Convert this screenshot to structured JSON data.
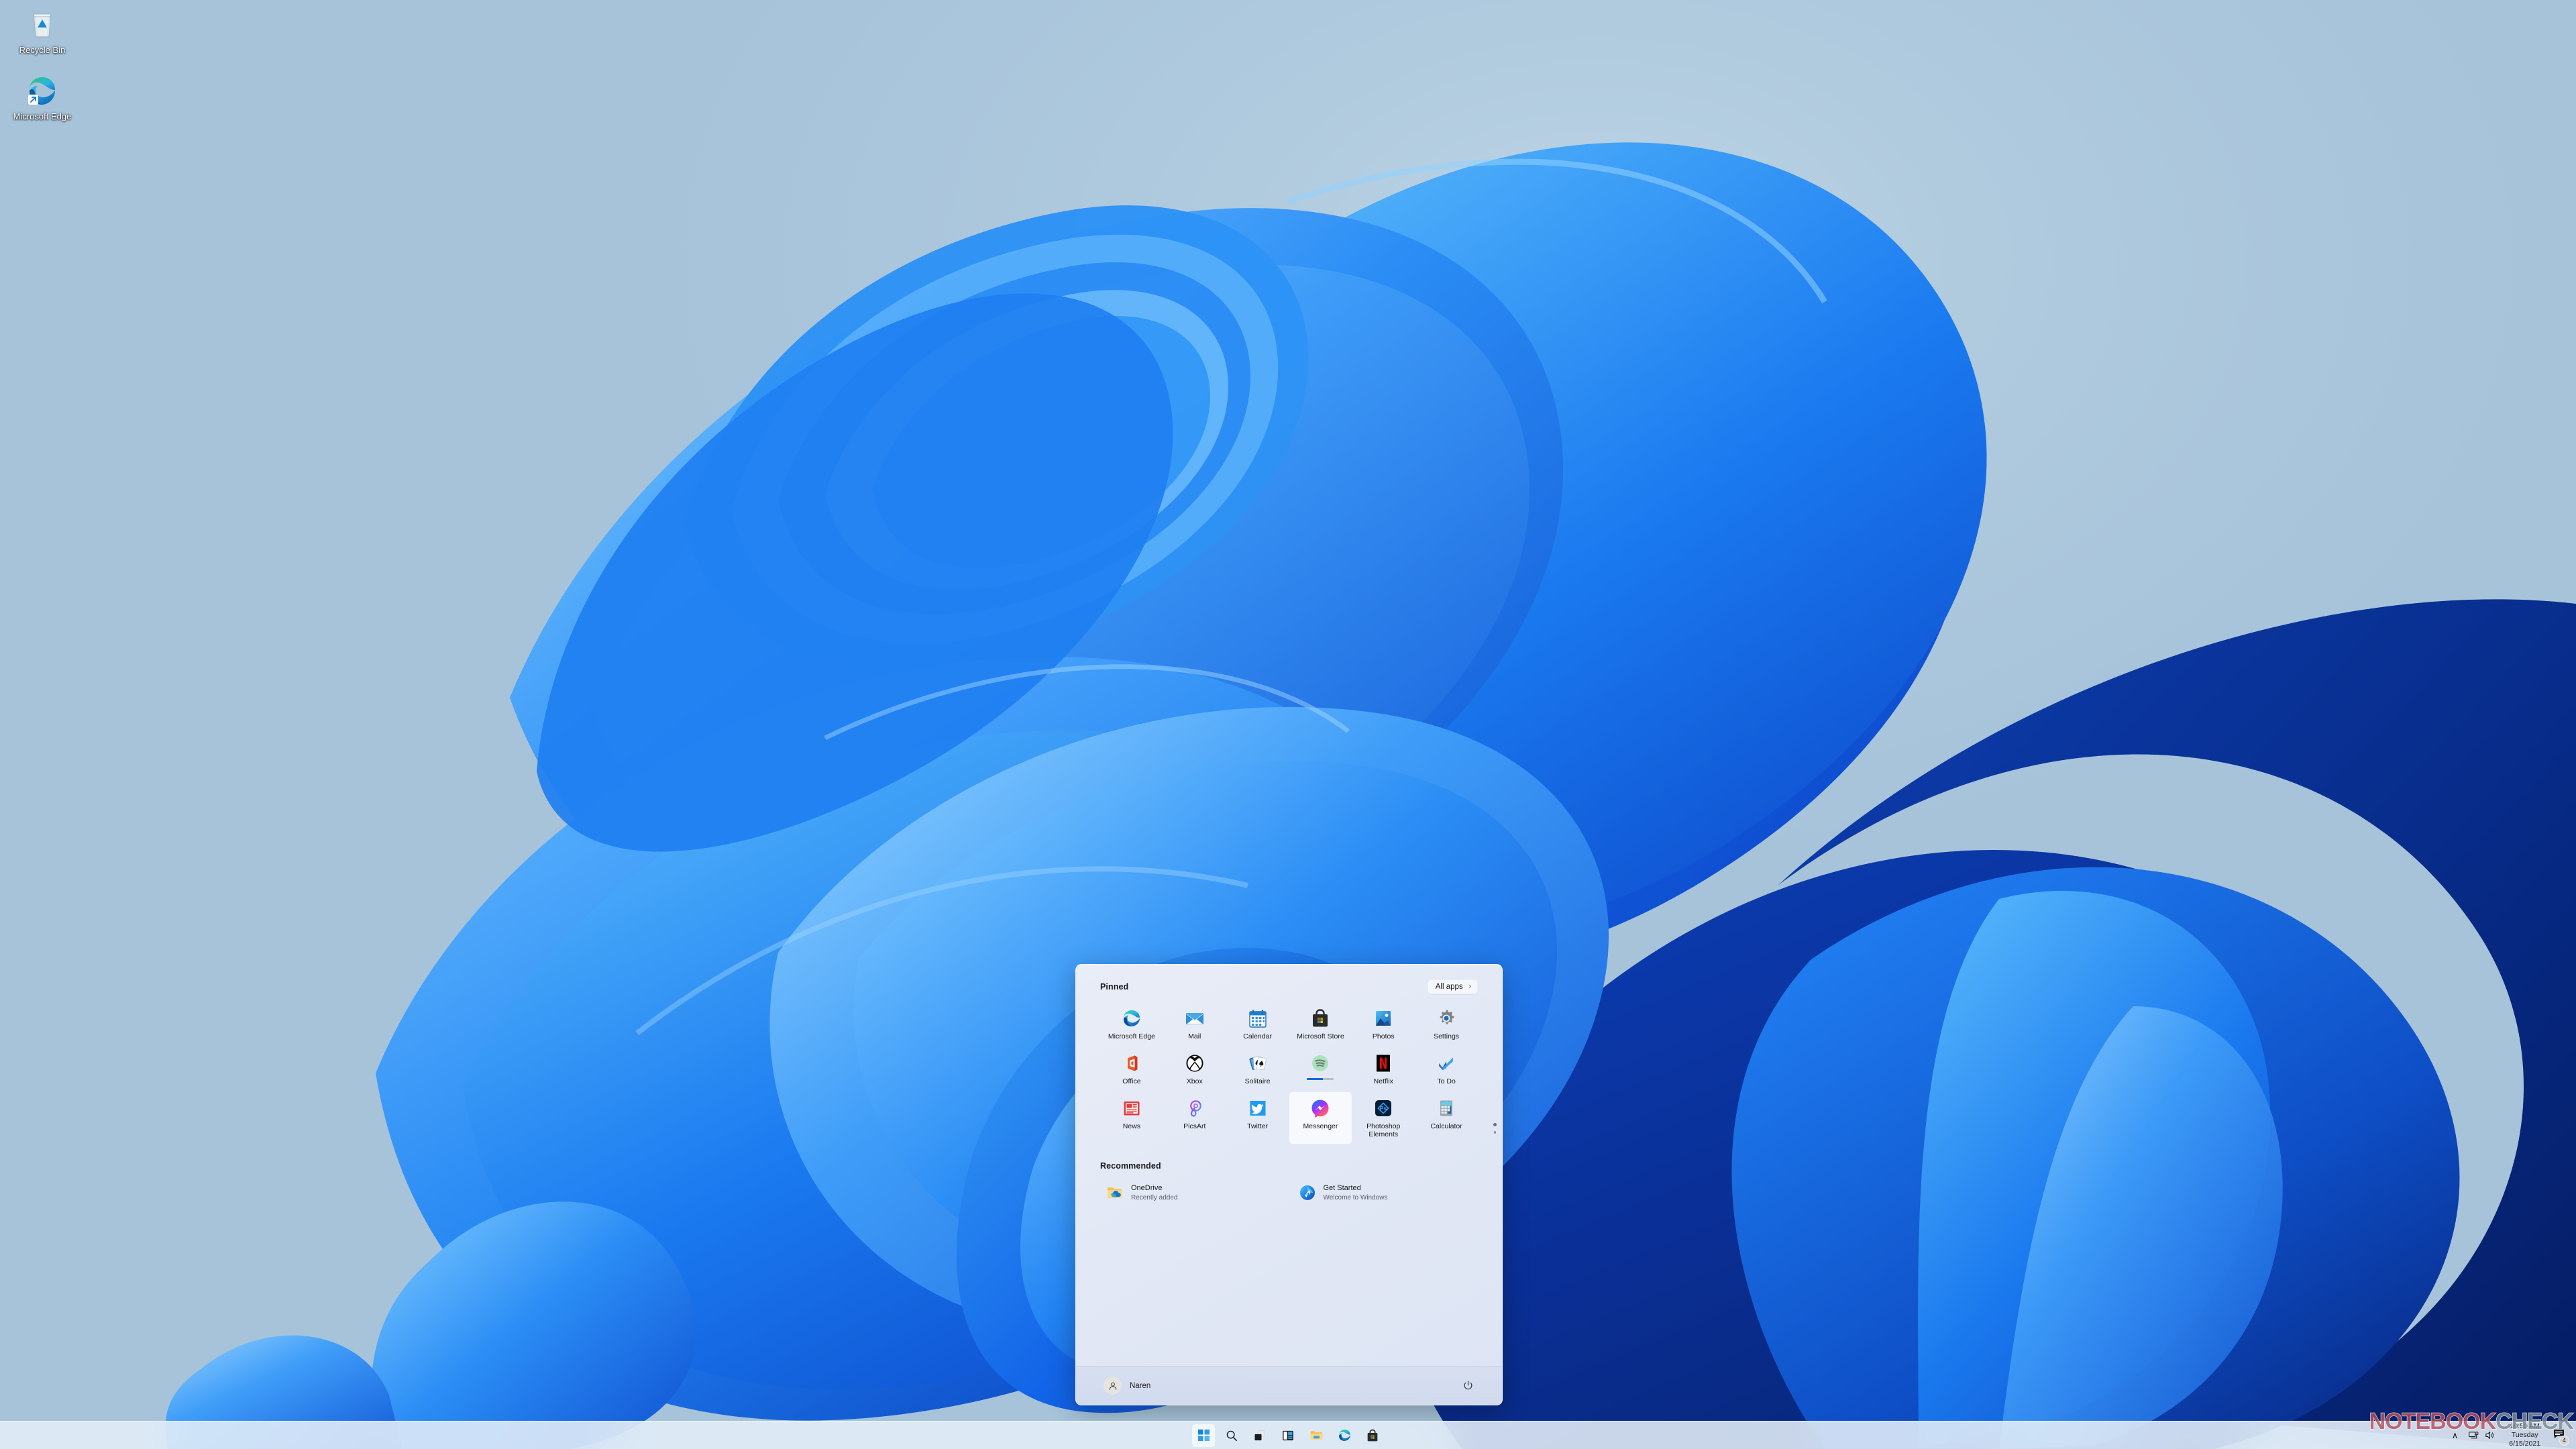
{
  "colors": {
    "accent": "#0b6fd4",
    "desktop_bg": "#a9c5de",
    "taskbar_bg": "#e4eef8",
    "startmenu_bg": "#e4eaf6",
    "watermark_red": "#b5505c",
    "watermark_gray": "#7f8a95"
  },
  "desktop": {
    "icons": [
      {
        "label": "Recycle Bin",
        "icon": "recycle-bin-icon"
      },
      {
        "label": "Microsoft Edge",
        "icon": "microsoft-edge-icon"
      }
    ]
  },
  "start_menu": {
    "pinned": {
      "title": "Pinned",
      "all_apps_label": "All apps",
      "all_apps_chevron": "›",
      "apps": [
        {
          "label": "Microsoft Edge",
          "icon": "microsoft-edge-icon",
          "state": "normal"
        },
        {
          "label": "Mail",
          "icon": "mail-icon",
          "state": "normal"
        },
        {
          "label": "Calendar",
          "icon": "calendar-icon",
          "state": "normal"
        },
        {
          "label": "Microsoft Store",
          "icon": "microsoft-store-icon",
          "state": "normal"
        },
        {
          "label": "Photos",
          "icon": "photos-icon",
          "state": "normal"
        },
        {
          "label": "Settings",
          "icon": "settings-gear-icon",
          "state": "normal"
        },
        {
          "label": "Office",
          "icon": "office-icon",
          "state": "normal"
        },
        {
          "label": "Xbox",
          "icon": "xbox-icon",
          "state": "normal"
        },
        {
          "label": "Solitaire",
          "icon": "solitaire-icon",
          "state": "normal"
        },
        {
          "label": "",
          "icon": "spotify-icon",
          "state": "installing",
          "progress": 60
        },
        {
          "label": "Netflix",
          "icon": "netflix-icon",
          "state": "normal"
        },
        {
          "label": "To Do",
          "icon": "to-do-icon",
          "state": "normal"
        },
        {
          "label": "News",
          "icon": "news-icon",
          "state": "normal"
        },
        {
          "label": "PicsArt",
          "icon": "picsart-icon",
          "state": "normal"
        },
        {
          "label": "Twitter",
          "icon": "twitter-icon",
          "state": "normal"
        },
        {
          "label": "Messenger",
          "icon": "messenger-icon",
          "state": "hovered"
        },
        {
          "label": "Photoshop Elements",
          "icon": "photoshop-elements-icon",
          "state": "normal"
        },
        {
          "label": "Calculator",
          "icon": "calculator-icon",
          "state": "normal"
        }
      ]
    },
    "recommended": {
      "title": "Recommended",
      "items": [
        {
          "title": "OneDrive",
          "subtitle": "Recently added",
          "icon": "onedrive-folder-icon"
        },
        {
          "title": "Get Started",
          "subtitle": "Welcome to Windows",
          "icon": "get-started-icon"
        }
      ]
    },
    "footer": {
      "user_name": "Naren",
      "avatar_icon": "user-avatar-icon",
      "power_icon": "power-icon"
    }
  },
  "taskbar": {
    "buttons": [
      {
        "name": "start",
        "icon": "windows-start-icon",
        "active": true
      },
      {
        "name": "search",
        "icon": "search-icon",
        "active": false
      },
      {
        "name": "task-view",
        "icon": "task-view-icon",
        "active": false
      },
      {
        "name": "widgets",
        "icon": "widgets-icon",
        "active": false
      },
      {
        "name": "file-explorer",
        "icon": "file-explorer-icon",
        "active": false
      },
      {
        "name": "microsoft-edge",
        "icon": "microsoft-edge-icon",
        "active": false
      },
      {
        "name": "microsoft-store",
        "icon": "microsoft-store-icon",
        "active": false
      }
    ],
    "tray": {
      "chevron_up": "∧",
      "network_icon": "network-icon",
      "volume_icon": "volume-icon",
      "clock_time": "10:50 AM",
      "clock_day": "Tuesday",
      "clock_date": "6/15/2021",
      "notification_icon": "notification-icon",
      "notification_count": "4"
    }
  },
  "watermark": {
    "part1": "NOTEBOOK",
    "part2": "CHECK"
  }
}
